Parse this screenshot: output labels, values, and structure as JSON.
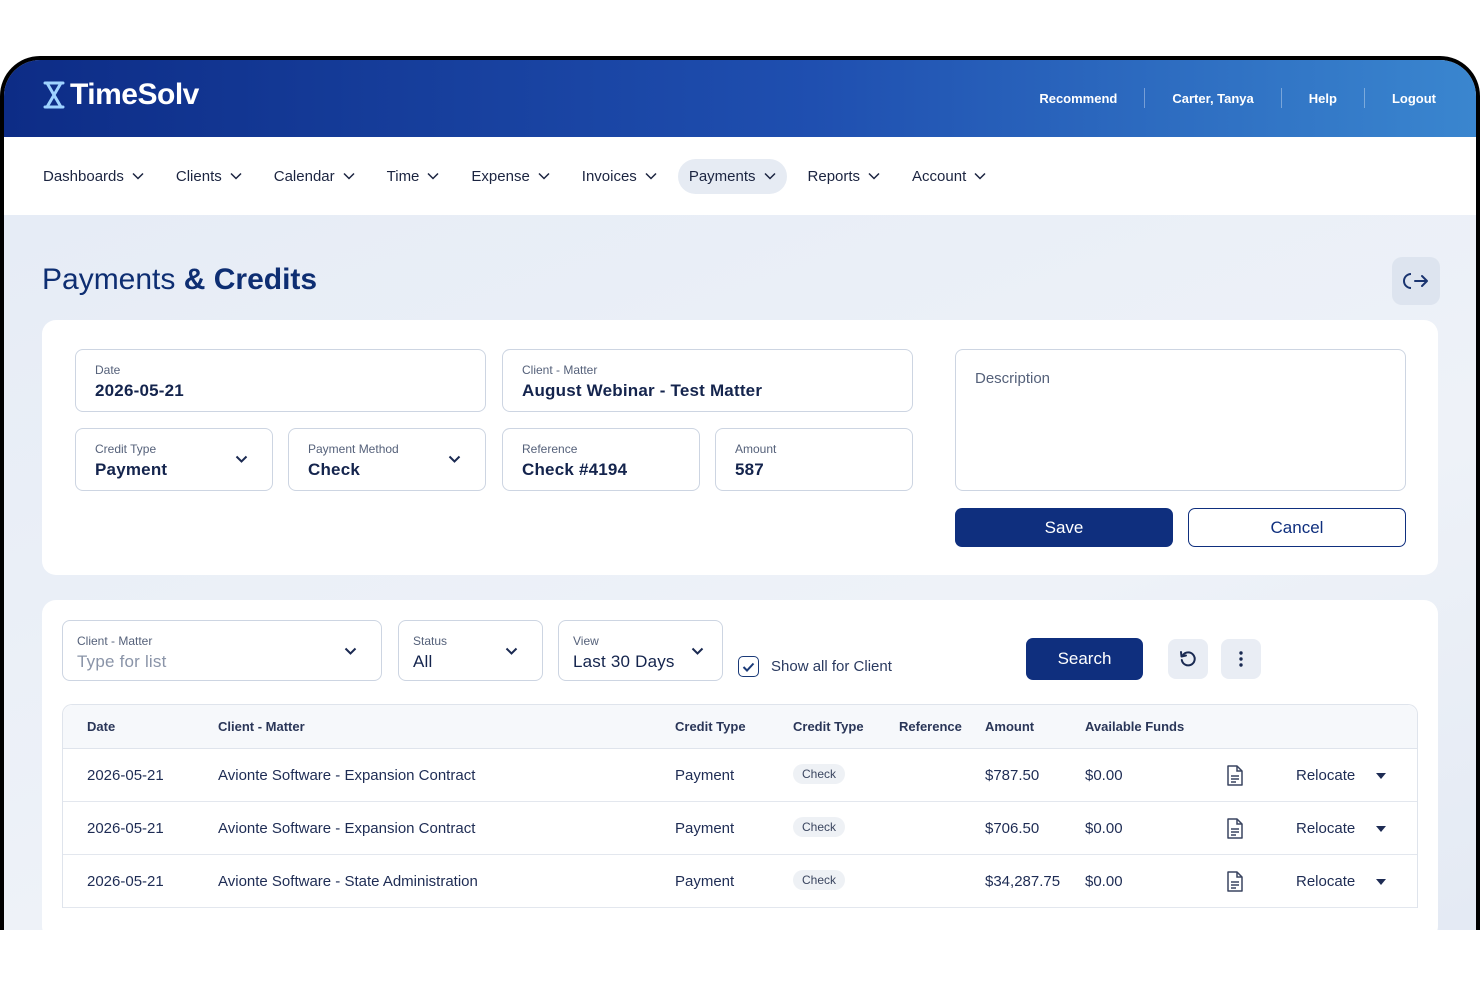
{
  "app": {
    "logo_text": "TimeSolv"
  },
  "header": {
    "links": [
      "Recommend",
      "Carter, Tanya",
      "Help",
      "Logout"
    ]
  },
  "nav": {
    "items": [
      {
        "label": "Dashboards"
      },
      {
        "label": "Clients"
      },
      {
        "label": "Calendar"
      },
      {
        "label": "Time"
      },
      {
        "label": "Expense"
      },
      {
        "label": "Invoices"
      },
      {
        "label": "Payments",
        "active": true
      },
      {
        "label": "Reports"
      },
      {
        "label": "Account"
      }
    ]
  },
  "page": {
    "title_light": "Payments",
    "title_bold": "& Credits"
  },
  "form": {
    "date": {
      "label": "Date",
      "value": "2026-05-21"
    },
    "client_matter": {
      "label": "Client - Matter",
      "value": "August Webinar - Test Matter"
    },
    "credit_type": {
      "label": "Credit Type",
      "value": "Payment"
    },
    "payment_method": {
      "label": "Payment Method",
      "value": "Check"
    },
    "reference": {
      "label": "Reference",
      "value": "Check #4194"
    },
    "amount": {
      "label": "Amount",
      "value": "587"
    },
    "description": {
      "placeholder": "Description"
    },
    "save_label": "Save",
    "cancel_label": "Cancel"
  },
  "filters": {
    "client_matter": {
      "label": "Client - Matter",
      "placeholder": "Type for list"
    },
    "status": {
      "label": "Status",
      "value": "All"
    },
    "view": {
      "label": "View",
      "value": "Last 30 Days"
    },
    "show_all_label": "Show all for Client",
    "show_all_checked": true,
    "search_label": "Search"
  },
  "table": {
    "columns": [
      "Date",
      "Client - Matter",
      "Credit Type",
      "Credit Type",
      "Reference",
      "Amount",
      "Available Funds"
    ],
    "rows": [
      {
        "date": "2026-05-21",
        "client_matter": "Avionte Software - Expansion Contract",
        "credit_type": "Payment",
        "method": "Check",
        "reference": "",
        "amount": "$787.50",
        "available": "$0.00",
        "action": "Relocate"
      },
      {
        "date": "2026-05-21",
        "client_matter": "Avionte Software - Expansion Contract",
        "credit_type": "Payment",
        "method": "Check",
        "reference": "",
        "amount": "$706.50",
        "available": "$0.00",
        "action": "Relocate"
      },
      {
        "date": "2026-05-21",
        "client_matter": "Avionte Software - State Administration",
        "credit_type": "Payment",
        "method": "Check",
        "reference": "",
        "amount": "$34,287.75",
        "available": "$0.00",
        "action": "Relocate"
      }
    ]
  },
  "colors": {
    "brand_dark": "#0f2f7e",
    "header_start": "#0d2c86",
    "header_end": "#3a86cf"
  }
}
